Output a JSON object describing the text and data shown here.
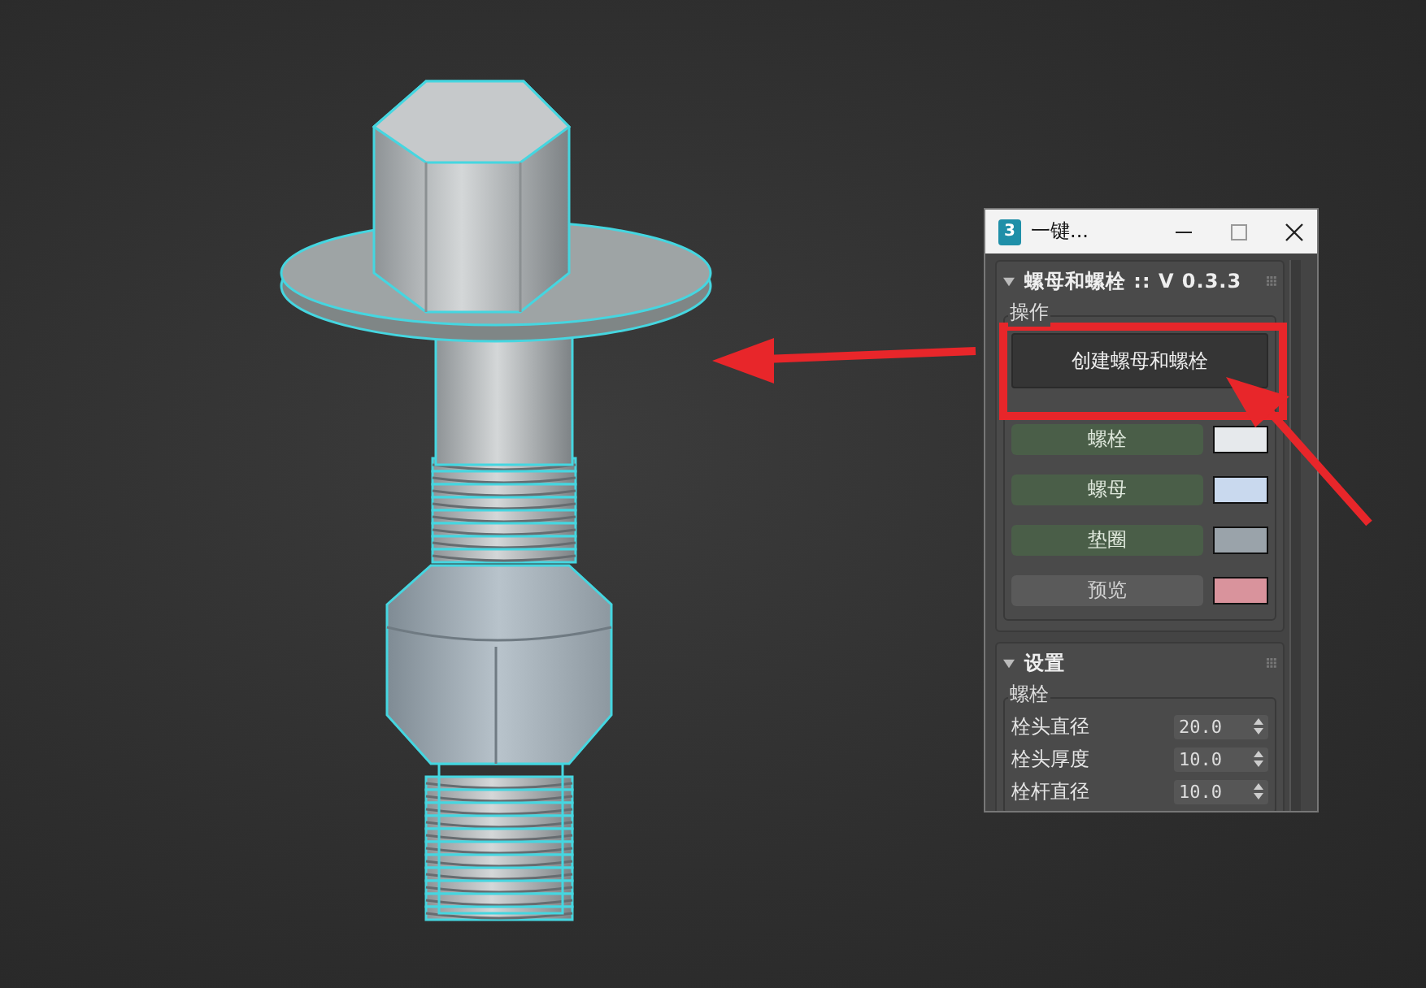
{
  "window": {
    "app_icon": "3",
    "title": "一键..."
  },
  "operations_rollout": {
    "title": "螺母和螺栓 :: V 0.3.3",
    "expanded": true,
    "group": "操作",
    "create_button": "创建螺母和螺栓",
    "parts": [
      {
        "label": "螺栓",
        "active": true,
        "color": "#e6e9ec"
      },
      {
        "label": "螺母",
        "active": true,
        "color": "#c9d9ee"
      },
      {
        "label": "垫圈",
        "active": true,
        "color": "#9aa3aa"
      },
      {
        "label": "预览",
        "active": false,
        "color": "#d9939c"
      }
    ]
  },
  "settings_rollout": {
    "title": "设置",
    "expanded": true,
    "group": "螺栓",
    "fields": [
      {
        "label": "栓头直径",
        "value": "20.0"
      },
      {
        "label": "栓头厚度",
        "value": "10.0"
      },
      {
        "label": "栓杆直径",
        "value": "10.0"
      }
    ]
  }
}
